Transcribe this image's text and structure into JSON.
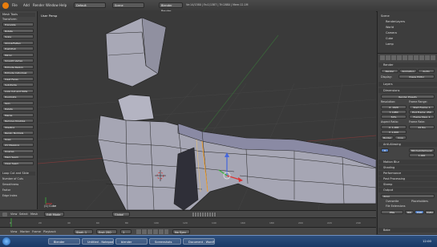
{
  "app": {
    "title": "Blender"
  },
  "top_menu": {
    "items": [
      "File",
      "Add",
      "Render",
      "Window",
      "Help"
    ]
  },
  "top_header": {
    "screen_layout": "Default",
    "scene": "Scene",
    "render_engine": "Blender Render",
    "stats": "Ve:14/1380 | Fa:1/1387 | Tri:2880 | Mem:12.1M"
  },
  "toolshelf": {
    "panel_title": "Mesh Tools",
    "transform_header": "Transform:",
    "buttons": [
      "Translate",
      "Rotate",
      "Scale",
      "Shrink/Fatten",
      "Push/Pull",
      "Mirror",
      "Smooth Vertex",
      "Extrude Region",
      "Extrude Individual",
      "Inset Faces",
      "Subdivide",
      "Loop Cut and Slide",
      "Duplicate",
      "Spin",
      "Delete",
      "Merge",
      "Remove Doubles",
      "Shading",
      "Recalc Normals",
      "Snap",
      "UV Mapping",
      "Unwrap",
      "Mark Seam",
      "Clear Seam"
    ],
    "op_header": "Loop Cut and Slide",
    "op_fields": [
      "Number of Cuts",
      "Smoothness",
      "Factor",
      "Edge Index"
    ]
  },
  "viewport": {
    "label": "User Persp",
    "axis_label": "(1) Cube"
  },
  "properties": {
    "tree_items": [
      "Scene",
      "RenderLayers",
      "World",
      "Camera",
      "Cube",
      "Lamp"
    ],
    "context": "Render",
    "sections": [
      "Render",
      "Dimensions",
      "Anti-Aliasing",
      "Motion Blur",
      "Shading",
      "Performance",
      "Post Processing",
      "Stamp",
      "Output",
      "Bake"
    ],
    "render_buttons": [
      "Render",
      "Animation",
      "Audio"
    ],
    "display_label": "Display:",
    "display_value": "Image Editor",
    "layers_label": "Layers",
    "preset": "Render Presets",
    "resolution_label": "Resolution:",
    "res_x": "X: 1920",
    "res_y": "Y: 1080",
    "res_pct": "50%",
    "frame_range_label": "Frame Range:",
    "start": "Start Frame: 1",
    "end": "End Frame: 250",
    "step": "Frame Step: 1",
    "aspect_label": "Aspect Ratio:",
    "aspect_x": "X: 1.000",
    "aspect_y": "Y: 1.000",
    "frame_rate_label": "Frame Rate:",
    "fps": "24 fps",
    "border": "Border",
    "crop": "Crop",
    "aa_samples": "8",
    "filter": "Mitchell-Netravali",
    "filter_size": "1.000",
    "output_path": "/tmp\\",
    "format": "PNG",
    "bw": "BW",
    "rgb": "RGB",
    "rgba": "RGBA",
    "overwrite": "Overwrite",
    "placeholders": "Placeholders",
    "file_extensions": "File Extensions"
  },
  "view_header": {
    "menus": [
      "View",
      "Select",
      "Mesh"
    ],
    "mode": "Edit Mode",
    "pivot": "Global"
  },
  "timeline": {
    "menus": [
      "View",
      "Marker",
      "Frame",
      "Playback"
    ],
    "start": "Start: 1",
    "end": "End: 250",
    "frame": "1",
    "sync": "No Sync",
    "ticks": [
      "0",
      "20",
      "40",
      "60",
      "80",
      "100",
      "120",
      "140",
      "160",
      "180",
      "200",
      "220",
      "240"
    ]
  },
  "taskbar": {
    "tasks": [
      "Blender",
      "Untitled - Notepad",
      "blender",
      "Screenshots",
      "Document - WordPad"
    ],
    "clock": "12:00"
  },
  "colors": {
    "mesh_face": "#a6a6b4",
    "mesh_edge": "#2a2a2a",
    "selected_edge": "#f0a030",
    "axis_red": "#cc4444",
    "axis_green": "#3cb43c",
    "axis_blue": "#4466dd"
  }
}
